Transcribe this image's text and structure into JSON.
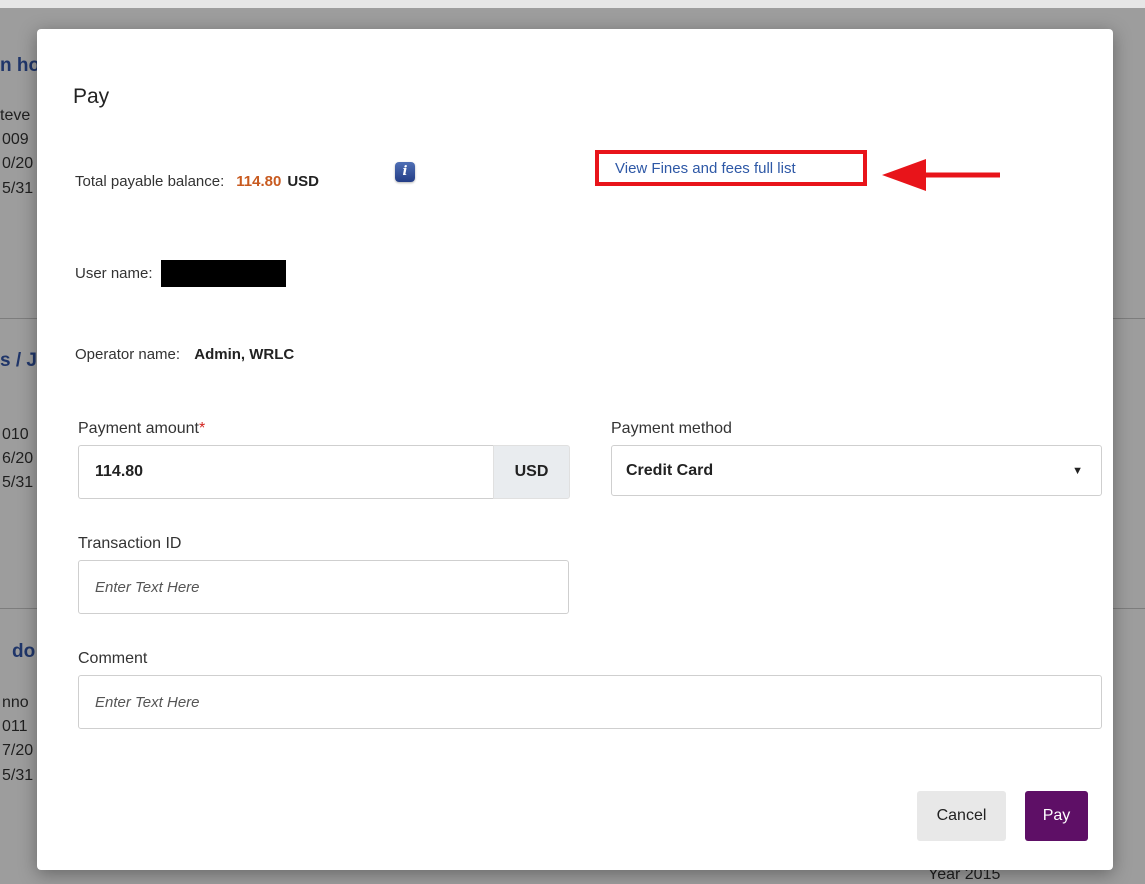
{
  "background": {
    "left_snippets": [
      "n ho",
      "teve",
      "009",
      "0/20",
      "5/31",
      "s / J",
      "010",
      "6/20",
      "5/31",
      "do",
      "nno",
      "011",
      "7/20",
      "5/31"
    ],
    "bottom_snippet": "Year 2015"
  },
  "modal": {
    "title": "Pay",
    "balance": {
      "label": "Total payable balance:",
      "amount": "114.80",
      "currency": "USD",
      "info_icon_glyph": "i"
    },
    "fines_link": "View Fines and fees full list",
    "user_name": {
      "label": "User name:"
    },
    "operator": {
      "label": "Operator name:",
      "value": "Admin, WRLC"
    },
    "payment_amount": {
      "label": "Payment amount",
      "required_mark": "*",
      "value": "114.80",
      "currency_addon": "USD"
    },
    "payment_method": {
      "label": "Payment method",
      "selected": "Credit Card"
    },
    "transaction_id": {
      "label": "Transaction ID",
      "placeholder": "Enter Text Here"
    },
    "comment": {
      "label": "Comment",
      "placeholder": "Enter Text Here"
    },
    "buttons": {
      "cancel": "Cancel",
      "pay": "Pay"
    }
  },
  "colors": {
    "pay_button": "#5e0f66",
    "balance_amount": "#c85a1f",
    "highlight_box": "#e8141a",
    "link": "#2e58a6"
  }
}
